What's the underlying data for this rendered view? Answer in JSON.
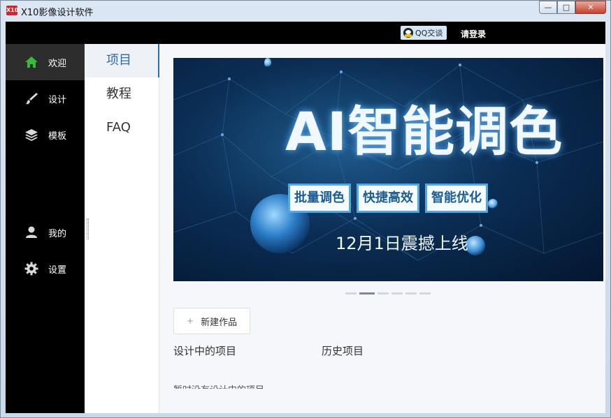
{
  "window": {
    "logo_text": "X10",
    "title": "X10影像设计软件",
    "controls": {
      "minimize": "—",
      "maximize": "□",
      "close": "✕"
    }
  },
  "topbar": {
    "qq_chat_label": "QQ交谈",
    "login_label": "请登录"
  },
  "sidebar": {
    "items": [
      {
        "label": "欢迎",
        "icon": "home-icon",
        "active": true
      },
      {
        "label": "设计",
        "icon": "brush-icon"
      },
      {
        "label": "模板",
        "icon": "layers-icon"
      },
      {
        "label": "我的",
        "icon": "user-icon"
      },
      {
        "label": "设置",
        "icon": "gear-icon"
      }
    ]
  },
  "subnav": {
    "items": [
      {
        "label": "项目",
        "active": true
      },
      {
        "label": "教程"
      },
      {
        "label": "FAQ"
      }
    ]
  },
  "banner": {
    "title": "AI智能调色",
    "tags": [
      "批量调色",
      "快捷高效",
      "智能优化"
    ],
    "date_line": "12月1日震撼上线"
  },
  "carousel": {
    "count": 6,
    "active_index": 1
  },
  "main": {
    "new_work_label": "新建作品",
    "tab_in_progress": "设计中的项目",
    "tab_history": "历史项目",
    "empty_text": "暂时没有设计中的项目"
  },
  "colors": {
    "accent": "#2f6da7",
    "sidebar_bg": "#000000",
    "home_icon": "#3cb83c"
  }
}
